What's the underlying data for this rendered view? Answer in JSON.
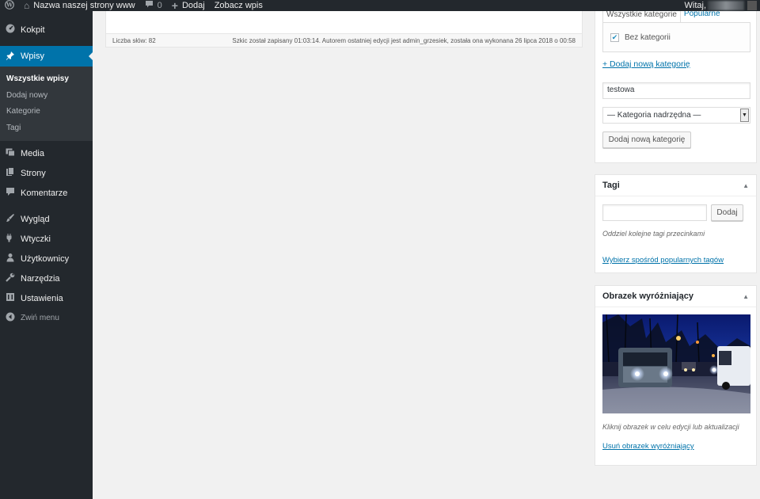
{
  "adminbar": {
    "wp_logo": "wordpress-icon",
    "site_name": "Nazwa naszej strony www",
    "comments_count": "0",
    "new_label": "Dodaj",
    "view_post_label": "Zobacz wpis",
    "greeting": "Witaj,"
  },
  "sidebar": {
    "items": [
      {
        "label": "Kokpit",
        "icon": "dashboard-icon"
      },
      {
        "label": "Wpisy",
        "icon": "pin-icon"
      },
      {
        "label": "Media",
        "icon": "media-icon"
      },
      {
        "label": "Strony",
        "icon": "pages-icon"
      },
      {
        "label": "Komentarze",
        "icon": "comments-icon"
      },
      {
        "label": "Wygląd",
        "icon": "appearance-icon"
      },
      {
        "label": "Wtyczki",
        "icon": "plugins-icon"
      },
      {
        "label": "Użytkownicy",
        "icon": "users-icon"
      },
      {
        "label": "Narzędzia",
        "icon": "tools-icon"
      },
      {
        "label": "Ustawienia",
        "icon": "settings-icon"
      }
    ],
    "submenu": [
      "Wszystkie wpisy",
      "Dodaj nowy",
      "Kategorie",
      "Tagi"
    ],
    "collapse_label": "Zwiń menu"
  },
  "editor": {
    "word_count": "Liczba słów: 82",
    "status": "Szkic został zapisany 01:03:14. Autorem ostatniej edycji jest admin_grzesiek, została ona wykonana 26 lipca 2018 o 00:58"
  },
  "categories": {
    "tab_all": "Wszystkie kategorie",
    "tab_popular": "Popularne",
    "items": [
      {
        "label": "Bez kategorii",
        "checked": true
      }
    ],
    "add_new_link": "+ Dodaj nową kategorię",
    "new_category_value": "testowa",
    "parent_select": "— Kategoria nadrzędna —",
    "add_button": "Dodaj nową kategorię"
  },
  "tags": {
    "title": "Tagi",
    "input_value": "",
    "add_button": "Dodaj",
    "hint": "Oddziel kolejne tagi przecinkami",
    "popular_link": "Wybierz spośród popularnych tagów"
  },
  "featured_image": {
    "title": "Obrazek wyróżniający",
    "hint": "Kliknij obrazek w celu edycji lub aktualizacji",
    "remove_link": "Usuń obrazek wyróżniający"
  }
}
